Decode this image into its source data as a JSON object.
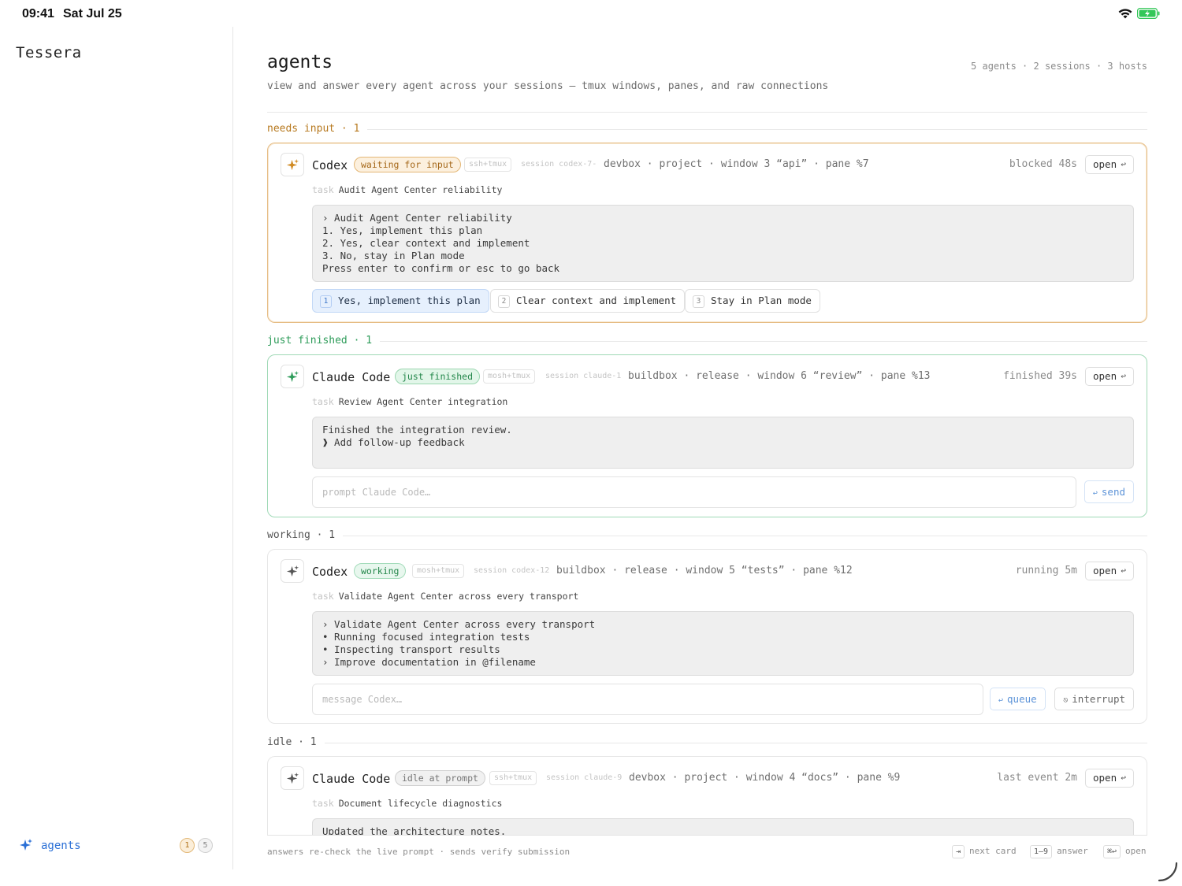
{
  "statusbar": {
    "time": "09:41",
    "date": "Sat Jul 25"
  },
  "sidebar": {
    "brand": "Tessera",
    "nav": {
      "label": "agents",
      "icon": "sparkle-icon",
      "badge_needs": "1",
      "badge_total": "5"
    }
  },
  "header": {
    "title": "agents",
    "subtitle": "view and answer every agent across your sessions — tmux windows, panes, and raw connections",
    "stats": "5 agents · 2 sessions · 3 hosts"
  },
  "sections": {
    "needs": "needs input · 1",
    "done": "just finished · 1",
    "work": "working · 1",
    "idle": "idle · 1"
  },
  "cards": [
    {
      "name": "Codex",
      "status": "waiting for input",
      "transport": "ssh+tmux",
      "session": "session codex-7-",
      "location": "devbox · project · window 3 “api” · pane %7",
      "elapsed": "blocked 48s",
      "open": "open",
      "task_label": "task",
      "task": "Audit Agent Center reliability",
      "terminal": [
        "› Audit Agent Center reliability",
        "1. Yes, implement this plan",
        "2. Yes, clear context and implement",
        "3. No, stay in Plan mode",
        "Press enter to confirm or esc to go back"
      ],
      "choices": [
        {
          "num": "1",
          "label": "Yes, implement this plan"
        },
        {
          "num": "2",
          "label": "Clear context and implement"
        },
        {
          "num": "3",
          "label": "Stay in Plan mode"
        }
      ]
    },
    {
      "name": "Claude Code",
      "status": "just finished",
      "transport": "mosh+tmux",
      "session": "session claude-1",
      "location": "buildbox · release · window 6 “review” · pane %13",
      "elapsed": "finished 39s",
      "open": "open",
      "task_label": "task",
      "task": "Review Agent Center integration",
      "terminal": [
        "Finished the integration review.",
        "",
        "❱ Add follow-up feedback"
      ],
      "input_placeholder": "prompt Claude Code…",
      "send": "send"
    },
    {
      "name": "Codex",
      "status": "working",
      "transport": "mosh+tmux",
      "session": "session codex-12",
      "location": "buildbox · release · window 5 “tests” · pane %12",
      "elapsed": "running 5m",
      "open": "open",
      "task_label": "task",
      "task": "Validate Agent Center across every transport",
      "terminal": [
        "› Validate Agent Center across every transport",
        "• Running focused integration tests",
        "• Inspecting transport results",
        "› Improve documentation in @filename"
      ],
      "input_placeholder": "message Codex…",
      "queue": "queue",
      "interrupt": "interrupt"
    },
    {
      "name": "Claude Code",
      "status": "idle at prompt",
      "transport": "ssh+tmux",
      "session": "session claude-9",
      "location": "devbox · project · window 4 “docs” · pane %9",
      "elapsed": "last event 2m",
      "open": "open",
      "task_label": "task",
      "task": "Document lifecycle diagnostics",
      "terminal": [
        "Updated the architecture notes."
      ]
    }
  ],
  "footer": {
    "note": "answers re-check the live prompt · sends verify submission",
    "hints": [
      {
        "key": "⇥",
        "label": "next card"
      },
      {
        "key": "1–9",
        "label": "answer"
      },
      {
        "key": "⌘↩",
        "label": "open"
      }
    ]
  },
  "colors": {
    "accent_blue": "#2a6fd6",
    "needs_orange": "#b7791f",
    "done_green": "#2e9c5a"
  }
}
